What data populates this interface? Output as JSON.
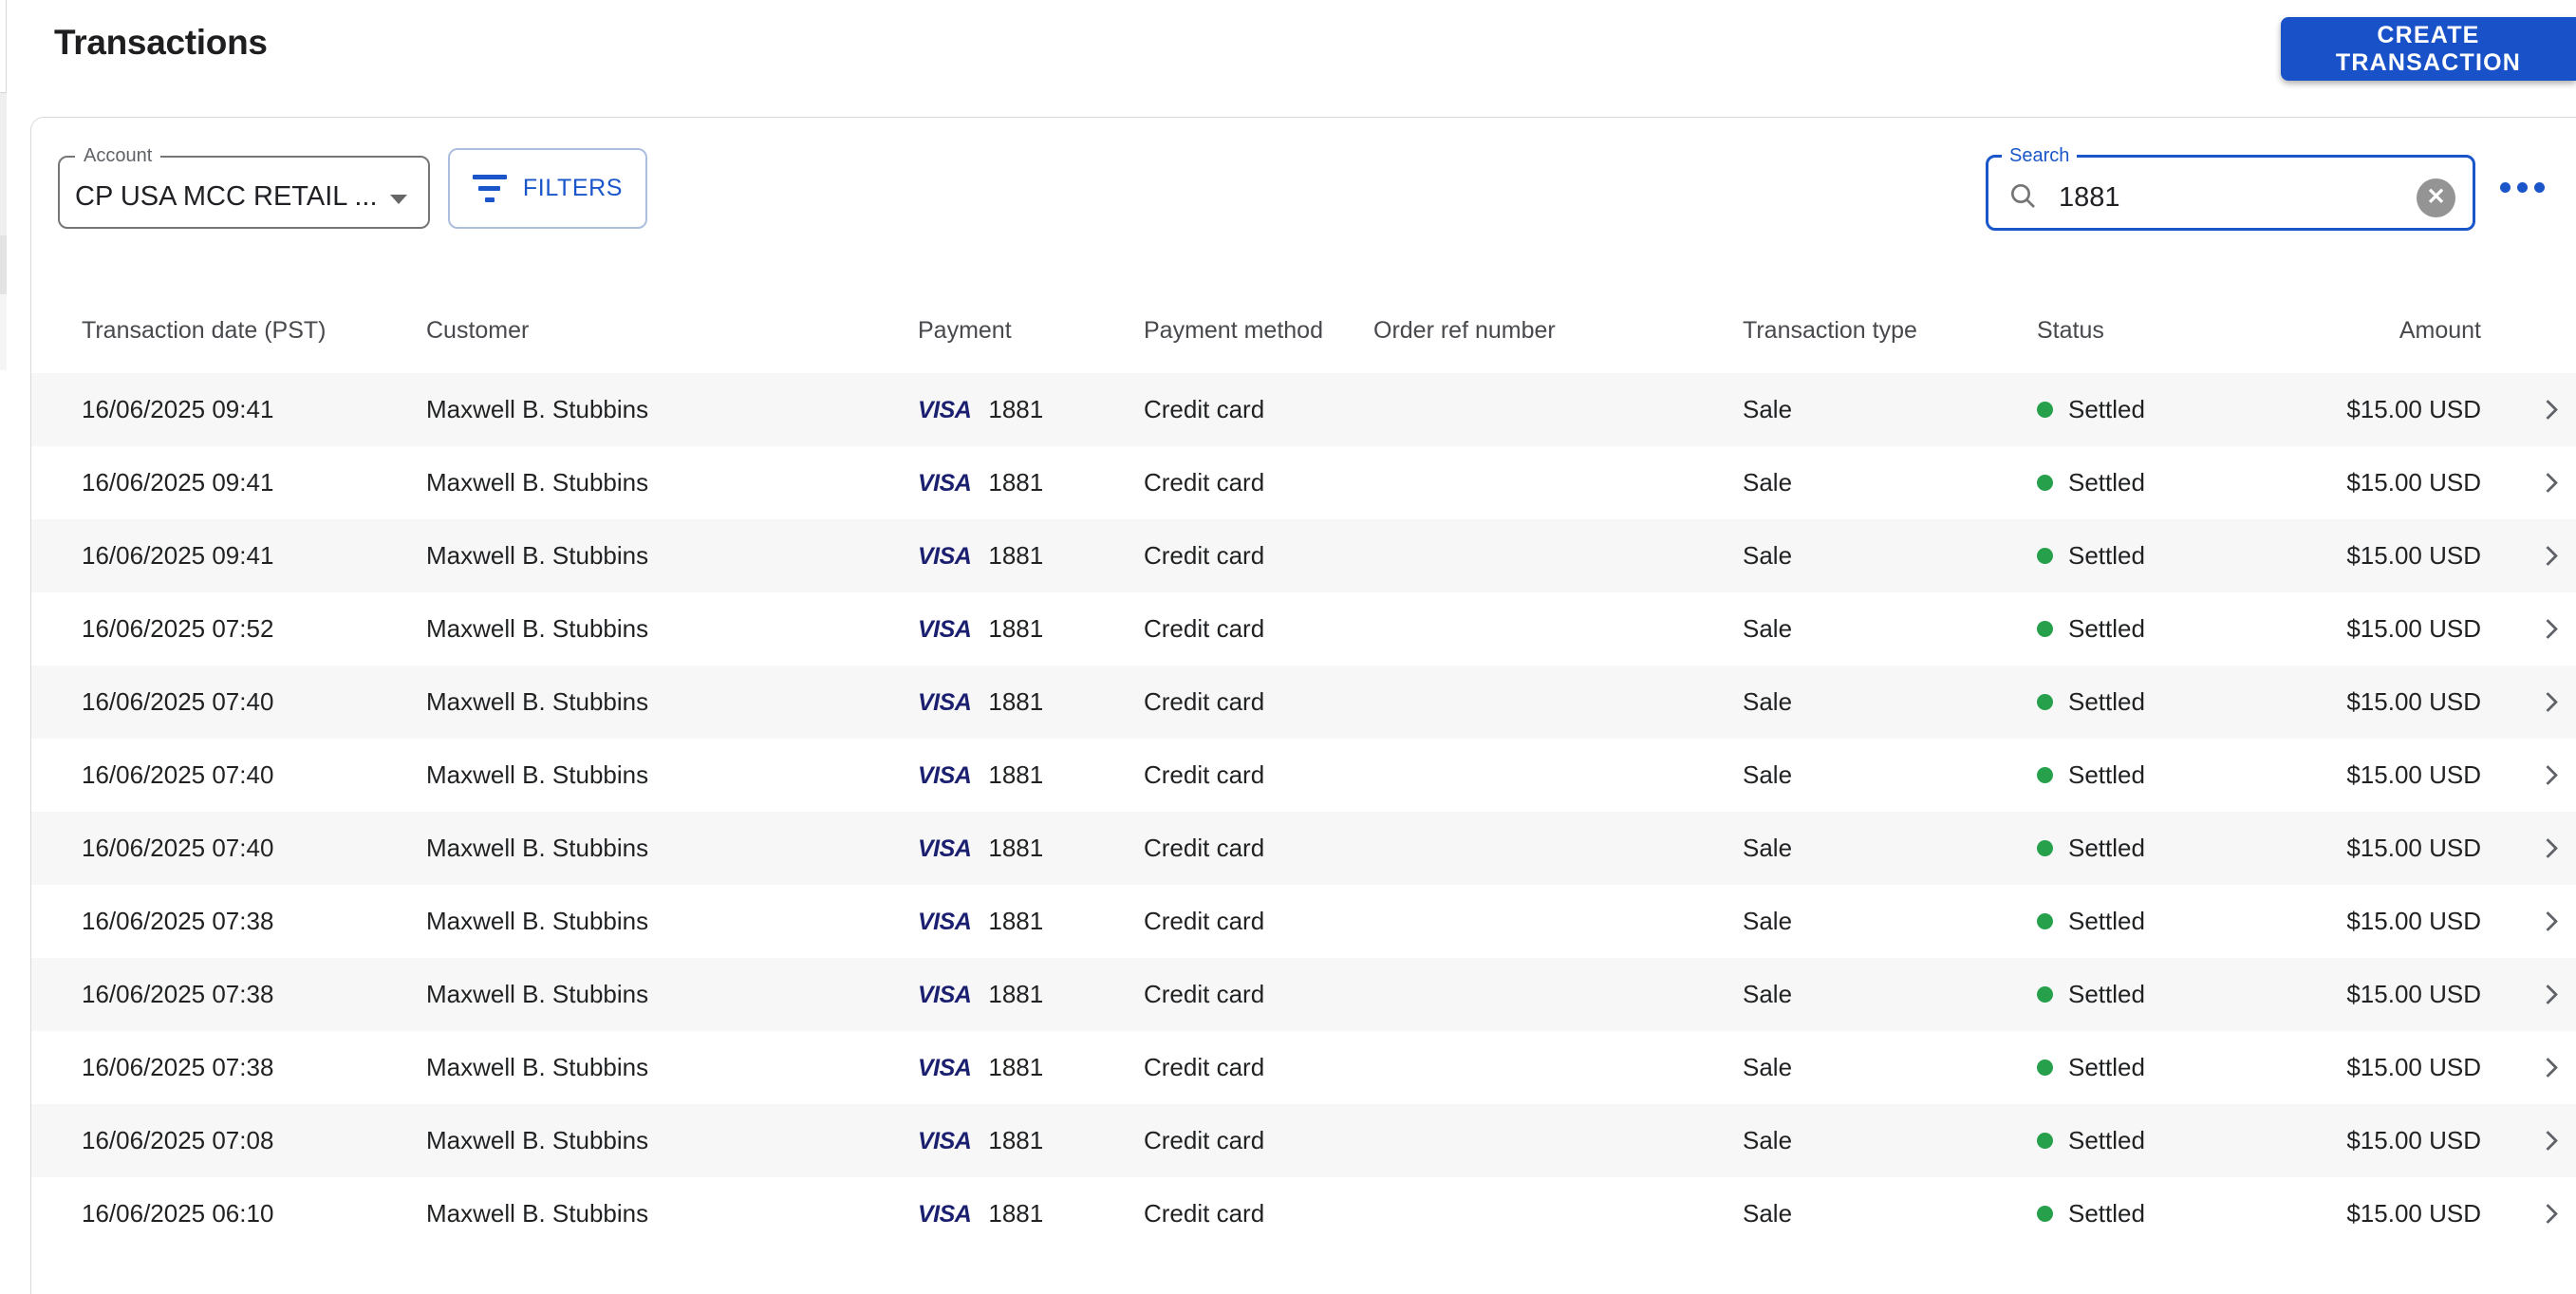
{
  "page": {
    "title": "Transactions"
  },
  "header": {
    "create_button": "CREATE TRANSACTION"
  },
  "filters": {
    "account": {
      "label": "Account",
      "value": "CP USA MCC RETAIL ..."
    },
    "filters_button": "FILTERS",
    "search": {
      "label": "Search",
      "value": "1881"
    },
    "clear_icon": "✕"
  },
  "table": {
    "columns": [
      "Transaction date (PST)",
      "Customer",
      "Payment",
      "Payment method",
      "Order ref number",
      "Transaction type",
      "Status",
      "Amount"
    ],
    "rows": [
      {
        "date": "16/06/2025 09:41",
        "customer": "Maxwell B. Stubbins",
        "card_scheme": "VISA",
        "card_number": "1881",
        "method": "Credit card",
        "order_ref": "",
        "type": "Sale",
        "status": "Settled",
        "amount": "$15.00 USD"
      },
      {
        "date": "16/06/2025 09:41",
        "customer": "Maxwell B. Stubbins",
        "card_scheme": "VISA",
        "card_number": "1881",
        "method": "Credit card",
        "order_ref": "",
        "type": "Sale",
        "status": "Settled",
        "amount": "$15.00 USD"
      },
      {
        "date": "16/06/2025 09:41",
        "customer": "Maxwell B. Stubbins",
        "card_scheme": "VISA",
        "card_number": "1881",
        "method": "Credit card",
        "order_ref": "",
        "type": "Sale",
        "status": "Settled",
        "amount": "$15.00 USD"
      },
      {
        "date": "16/06/2025 07:52",
        "customer": "Maxwell B. Stubbins",
        "card_scheme": "VISA",
        "card_number": "1881",
        "method": "Credit card",
        "order_ref": "",
        "type": "Sale",
        "status": "Settled",
        "amount": "$15.00 USD"
      },
      {
        "date": "16/06/2025 07:40",
        "customer": "Maxwell B. Stubbins",
        "card_scheme": "VISA",
        "card_number": "1881",
        "method": "Credit card",
        "order_ref": "",
        "type": "Sale",
        "status": "Settled",
        "amount": "$15.00 USD"
      },
      {
        "date": "16/06/2025 07:40",
        "customer": "Maxwell B. Stubbins",
        "card_scheme": "VISA",
        "card_number": "1881",
        "method": "Credit card",
        "order_ref": "",
        "type": "Sale",
        "status": "Settled",
        "amount": "$15.00 USD"
      },
      {
        "date": "16/06/2025 07:40",
        "customer": "Maxwell B. Stubbins",
        "card_scheme": "VISA",
        "card_number": "1881",
        "method": "Credit card",
        "order_ref": "",
        "type": "Sale",
        "status": "Settled",
        "amount": "$15.00 USD"
      },
      {
        "date": "16/06/2025 07:38",
        "customer": "Maxwell B. Stubbins",
        "card_scheme": "VISA",
        "card_number": "1881",
        "method": "Credit card",
        "order_ref": "",
        "type": "Sale",
        "status": "Settled",
        "amount": "$15.00 USD"
      },
      {
        "date": "16/06/2025 07:38",
        "customer": "Maxwell B. Stubbins",
        "card_scheme": "VISA",
        "card_number": "1881",
        "method": "Credit card",
        "order_ref": "",
        "type": "Sale",
        "status": "Settled",
        "amount": "$15.00 USD"
      },
      {
        "date": "16/06/2025 07:38",
        "customer": "Maxwell B. Stubbins",
        "card_scheme": "VISA",
        "card_number": "1881",
        "method": "Credit card",
        "order_ref": "",
        "type": "Sale",
        "status": "Settled",
        "amount": "$15.00 USD"
      },
      {
        "date": "16/06/2025 07:08",
        "customer": "Maxwell B. Stubbins",
        "card_scheme": "VISA",
        "card_number": "1881",
        "method": "Credit card",
        "order_ref": "",
        "type": "Sale",
        "status": "Settled",
        "amount": "$15.00 USD"
      },
      {
        "date": "16/06/2025 06:10",
        "customer": "Maxwell B. Stubbins",
        "card_scheme": "VISA",
        "card_number": "1881",
        "method": "Credit card",
        "order_ref": "",
        "type": "Sale",
        "status": "Settled",
        "amount": "$15.00 USD"
      }
    ]
  },
  "colors": {
    "accent_blue": "#1a56c9",
    "button_blue": "#1952c8",
    "visa_blue": "#1b1f70",
    "status_green": "#27a04c",
    "row_alt": "#f7f7f7"
  }
}
